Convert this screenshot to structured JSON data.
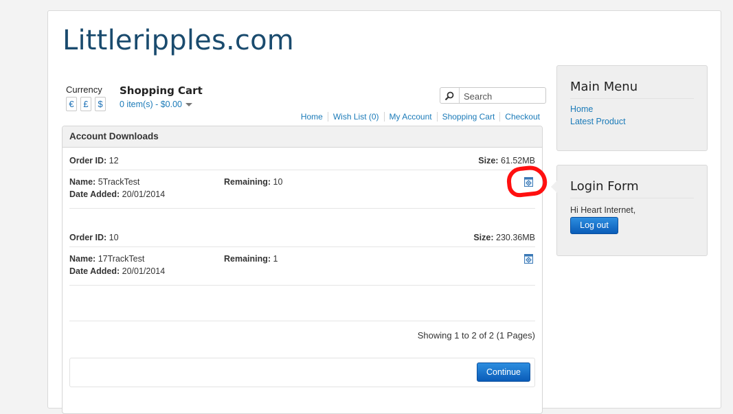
{
  "site": {
    "title": "Littleripples.com"
  },
  "currency": {
    "label": "Currency",
    "symbols": [
      "€",
      "£",
      "$"
    ]
  },
  "cart": {
    "title": "Shopping Cart",
    "summary": "0 item(s) - $0.00"
  },
  "search": {
    "placeholder": "Search",
    "icon": "search-icon"
  },
  "nav": [
    "Home",
    "Wish List (0)",
    "My Account",
    "Shopping Cart",
    "Checkout"
  ],
  "downloads": {
    "heading": "Account Downloads",
    "labels": {
      "order_id": "Order ID:",
      "size": "Size:",
      "name": "Name:",
      "date_added": "Date Added:",
      "remaining": "Remaining:"
    },
    "items": [
      {
        "order_id": "12",
        "size": "61.52MB",
        "name": "5TrackTest",
        "date_added": "20/01/2014",
        "remaining": "10",
        "icon": "download-icon"
      },
      {
        "order_id": "10",
        "size": "230.36MB",
        "name": "17TrackTest",
        "date_added": "20/01/2014",
        "remaining": "1",
        "icon": "download-icon"
      }
    ],
    "pagination": "Showing 1 to 2 of 2 (1 Pages)",
    "continue_label": "Continue"
  },
  "main_menu": {
    "title": "Main Menu",
    "links": [
      "Home",
      "Latest Product"
    ]
  },
  "login_form": {
    "title": "Login Form",
    "greeting": "Hi Heart Internet,",
    "logout_label": "Log out"
  },
  "colors": {
    "link": "#1a7ab8",
    "title": "#1a4b6e",
    "button": "#0a5cb8",
    "annotation": "#ff1010"
  }
}
